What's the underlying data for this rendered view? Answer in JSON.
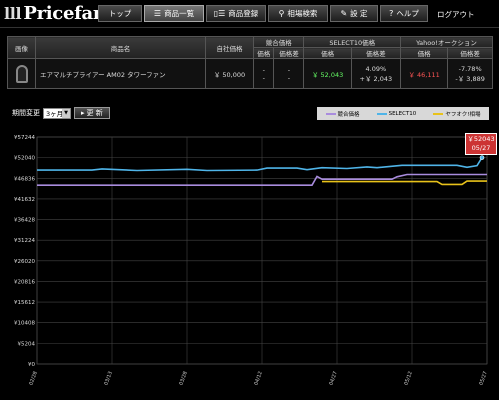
{
  "app": {
    "logo_text": "Pricefan",
    "logo_mark": "lll"
  },
  "nav": {
    "items": [
      {
        "label": "トップ",
        "icon": ""
      },
      {
        "label": "商品一覧",
        "icon": "list-icon",
        "glyph": "☰"
      },
      {
        "label": "商品登録",
        "icon": "register-icon",
        "glyph": "▯☰"
      },
      {
        "label": "相場検索",
        "icon": "search-icon",
        "glyph": "⚲"
      },
      {
        "label": "設 定",
        "icon": "wrench-icon",
        "glyph": "✎"
      },
      {
        "label": "ヘルプ",
        "icon": "help-icon",
        "glyph": "?"
      }
    ],
    "logout": "ログアウト"
  },
  "table": {
    "headers": {
      "image": "画像",
      "name": "商品名",
      "own_price": "自社価格",
      "competitor": "競合価格",
      "select10": "SELECT10価格",
      "yahoo": "Yahoo!オークション",
      "price": "価格",
      "diff": "価格差"
    },
    "row": {
      "name": "エアマルチプライアー AM02 タワーファン",
      "own_price": "￥ 50,000",
      "competitor_price": "-",
      "competitor_sub": "-",
      "competitor_diff": "-",
      "competitor_diff_sub": "-",
      "select10_price": "￥ 52,043",
      "select10_pct": "4.09%",
      "select10_diff": "+￥ 2,043",
      "yahoo_price": "￥ 46,111",
      "yahoo_pct": "-7.78%",
      "yahoo_diff": "-￥ 3,889"
    }
  },
  "controls": {
    "period_label": "期間変更",
    "period_value": "3ヶ月",
    "update_label": "更 新"
  },
  "tooltip": {
    "price": "￥52043",
    "date": "05/27"
  },
  "colors": {
    "competitor": "#a98cde",
    "select10": "#4fb4e8",
    "yahoo": "#e8c21a",
    "tooltip": "#cc3333"
  },
  "chart_data": {
    "type": "line",
    "ylim": [
      0,
      57244
    ],
    "y_ticks": [
      "¥0",
      "¥5204",
      "¥10408",
      "¥15612",
      "¥20816",
      "¥26020",
      "¥31224",
      "¥36428",
      "¥41632",
      "¥46836",
      "¥52040",
      "¥57244"
    ],
    "x_ticks": [
      "02/28",
      "03/13",
      "03/28",
      "04/12",
      "04/27",
      "05/12",
      "05/27"
    ],
    "legend": [
      "競合価格",
      "SELECT10",
      "ヤフオク!相場"
    ],
    "series": [
      {
        "name": "競合価格",
        "color": "#a98cde",
        "points": [
          [
            0,
            45100
          ],
          [
            55,
            45100
          ],
          [
            56,
            47300
          ],
          [
            57,
            46600
          ],
          [
            71,
            46600
          ],
          [
            72,
            47200
          ],
          [
            74,
            47800
          ],
          [
            90,
            47800
          ]
        ]
      },
      {
        "name": "SELECT10",
        "color": "#4fb4e8",
        "points": [
          [
            0,
            48900
          ],
          [
            11,
            48900
          ],
          [
            13,
            49200
          ],
          [
            20,
            48800
          ],
          [
            30,
            49100
          ],
          [
            34,
            48800
          ],
          [
            44,
            48900
          ],
          [
            46,
            49400
          ],
          [
            52,
            49400
          ],
          [
            54,
            49000
          ],
          [
            57,
            49500
          ],
          [
            62,
            49300
          ],
          [
            66,
            49700
          ],
          [
            68,
            49500
          ],
          [
            73,
            50100
          ],
          [
            84,
            50100
          ],
          [
            86,
            49600
          ],
          [
            88,
            50000
          ],
          [
            89,
            52043
          ]
        ]
      },
      {
        "name": "ヤフオク!相場",
        "color": "#e8c21a",
        "points": [
          [
            57,
            46000
          ],
          [
            80,
            46000
          ],
          [
            81,
            45300
          ],
          [
            85,
            45300
          ],
          [
            86,
            46111
          ],
          [
            90,
            46111
          ]
        ]
      }
    ]
  }
}
